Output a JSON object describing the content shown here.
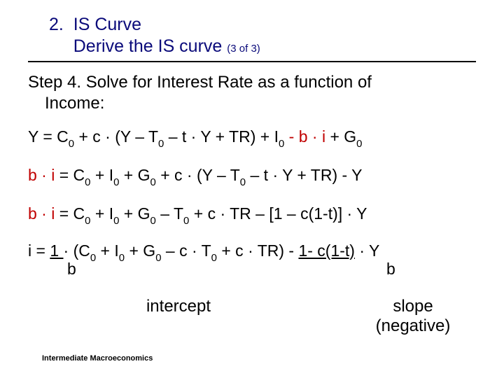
{
  "title": {
    "number": "2.",
    "line1": "IS Curve",
    "line2_a": "Derive the IS curve ",
    "line2_b": "(3 of 3)"
  },
  "step": {
    "label": "Step 4.",
    "text_a": "  Solve for Interest Rate as a function of",
    "text_b": "Income:"
  },
  "eq1": {
    "a": "Y = C",
    "s1": "0",
    "b": " + c · (Y – T",
    "s2": "0",
    "c": " – t · Y + TR) + I",
    "s3": "0",
    "d": " ",
    "red": "- b · i",
    "e": " + G",
    "s4": "0"
  },
  "eq2": {
    "red": "b · i",
    "a": " = C",
    "s1": "0",
    "b": " + I",
    "s2": "0",
    "c": " + G",
    "s3": "0",
    "d": " + c · (Y – T",
    "s4": "0",
    "e": " – t · Y + TR) - Y"
  },
  "eq3": {
    "red": "b · i",
    "a": " = C",
    "s1": "0",
    "b": " + I",
    "s2": "0",
    "c": " + G",
    "s3": "0",
    "d": " – T",
    "s4": "0",
    "e": " + c · TR – [1 – c(1-t)] · Y"
  },
  "eq4": {
    "a": "i = ",
    "u1": "  1  ",
    "b": " · (C",
    "s1": "0",
    "c": " + I",
    "s2": "0",
    "d": " + G",
    "s3": "0",
    "e": " – c · T",
    "s4": "0",
    "f": " + c · TR) - ",
    "u2": "1- c(1-t)",
    "g": " · Y",
    "den_left": "b",
    "den_right": "b"
  },
  "labels": {
    "intercept": "intercept",
    "slope_a": "slope",
    "slope_b": "(negative)"
  },
  "footer": "Intermediate Macroeconomics"
}
